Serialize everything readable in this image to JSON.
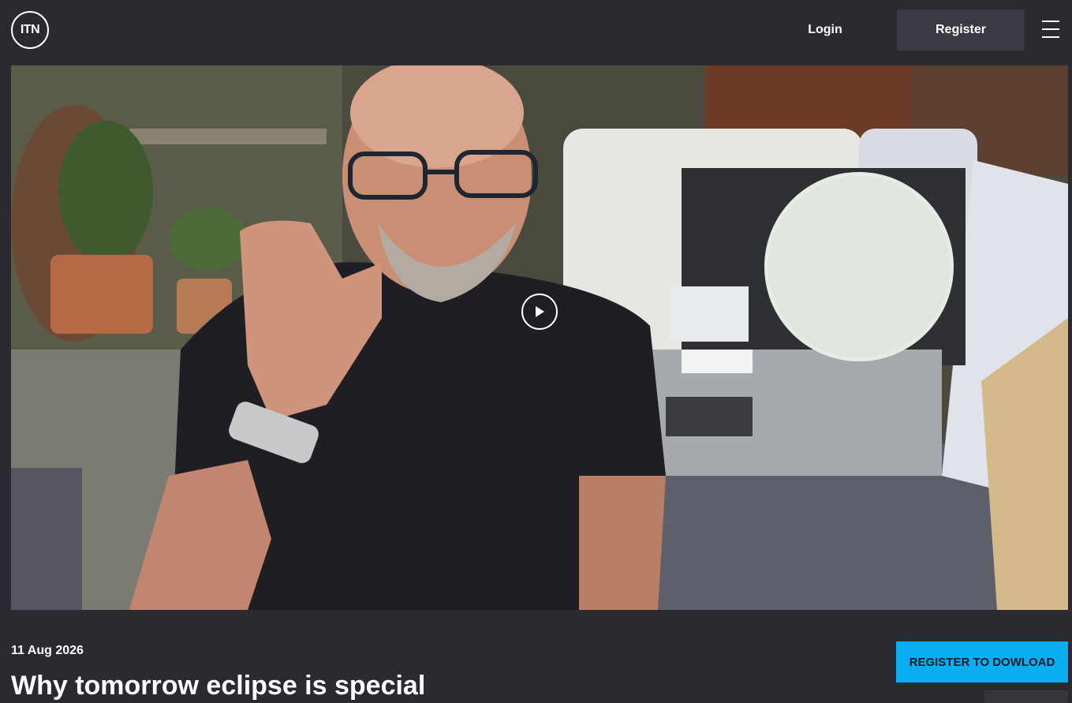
{
  "header": {
    "logo_text": "ITN",
    "login_label": "Login",
    "register_label": "Register",
    "menu_icon": "hamburger-menu-icon"
  },
  "video": {
    "play_icon": "play-icon"
  },
  "article": {
    "date": "11 Aug 2026",
    "title": "Why tomorrow eclipse is special",
    "download_label": "REGISTER TO DOWLOAD"
  },
  "colors": {
    "background": "#2a2a30",
    "register_button_bg": "#3a3a42",
    "download_button_bg": "#0aaef0"
  }
}
